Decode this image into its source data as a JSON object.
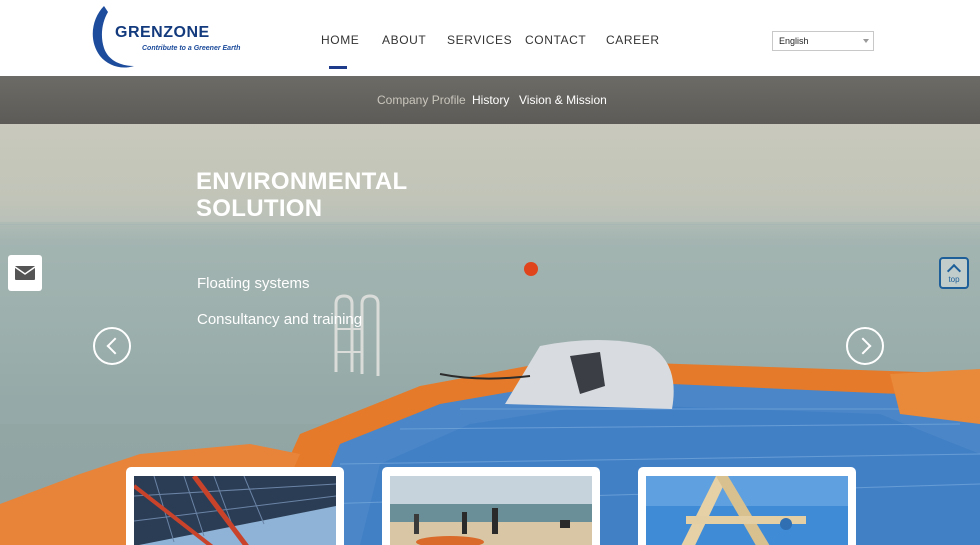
{
  "brand": {
    "name": "GRENZONE",
    "tagline": "Contribute to a Greener Earth"
  },
  "nav": {
    "items": [
      {
        "label": "HOME",
        "active": true
      },
      {
        "label": "ABOUT",
        "active": false
      },
      {
        "label": "SERVICES",
        "active": false
      },
      {
        "label": "CONTACT",
        "active": false
      },
      {
        "label": "CAREER",
        "active": false
      }
    ]
  },
  "language": {
    "selected": "English"
  },
  "subnav": {
    "items": [
      {
        "label": "Company Profile",
        "current": true
      },
      {
        "label": "History",
        "current": false
      },
      {
        "label": "Vision & Mission",
        "current": false
      }
    ]
  },
  "hero": {
    "title_line1": "ENVIRONMENTAL",
    "title_line2": "SOLUTION",
    "items": [
      "Floating systems",
      "Consultancy and training"
    ]
  },
  "top_button": {
    "label": "top"
  },
  "colors": {
    "brand_blue": "#123a7d",
    "nav_active": "#1e3a8a",
    "subnav_bg": "#6d6b66",
    "top_button": "#1e5f9a"
  },
  "icons": [
    "mail-icon",
    "chevron-left-icon",
    "chevron-right-icon",
    "chevron-up-icon",
    "dropdown-arrow-icon"
  ]
}
